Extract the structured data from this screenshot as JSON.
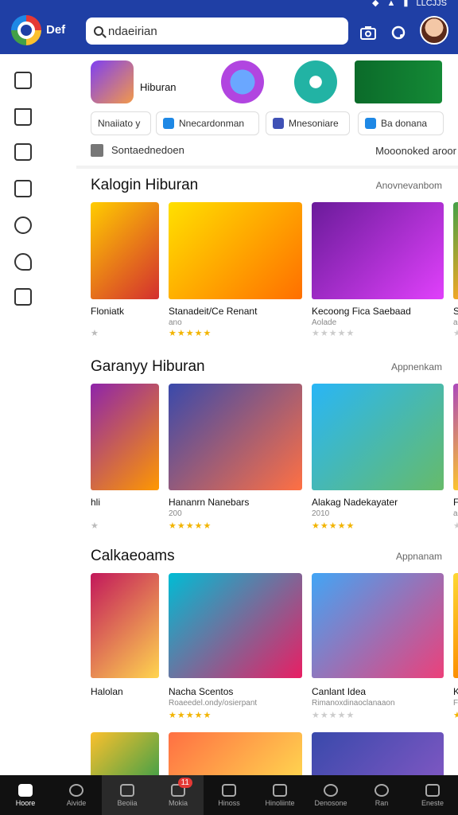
{
  "status": {
    "time": "LLCJJS"
  },
  "header": {
    "brand": "Def",
    "search_value": "ndaeirian"
  },
  "featured": {
    "label": "Hiburan"
  },
  "chips": [
    {
      "label": "Nnaiiato y"
    },
    {
      "label": "Nnecardonman"
    },
    {
      "label": "Mnesoniare"
    },
    {
      "label": "Ba donana"
    }
  ],
  "notice": {
    "left": "Sontaednedoen",
    "right": "Mooonoked aroor"
  },
  "sections": [
    {
      "title": "Kalogin Hiburan",
      "more": "Anovnevanbom",
      "cards": [
        {
          "title": "Floniatk",
          "sub": "",
          "stars": "★"
        },
        {
          "title": "Stanadeit/Ce Renant",
          "sub": "ano",
          "stars": "★★★★★"
        },
        {
          "title": "Kecoong Fica Saebaad",
          "sub": "Aolade",
          "stars": "★★★★★"
        },
        {
          "title": "S",
          "sub": "ae",
          "stars": "★"
        }
      ]
    },
    {
      "title": "Garanyy Hiburan",
      "more": "Appnenkam",
      "cards": [
        {
          "title": "hli",
          "sub": "",
          "stars": "★"
        },
        {
          "title": "Hananrn Nanebars",
          "sub": "200",
          "stars": "★★★★★"
        },
        {
          "title": "Alakag Nadekayater",
          "sub": "2010",
          "stars": "★★★★★"
        },
        {
          "title": "F",
          "sub": "ao",
          "stars": "★"
        }
      ]
    },
    {
      "title": "Calkaeoams",
      "more": "Appnanam",
      "cards": [
        {
          "title": "Halolan",
          "sub": "",
          "stars": ""
        },
        {
          "title": "Nacha Scentos",
          "sub": "Roaeedel.ondy/osierpant",
          "stars": "★★★★★"
        },
        {
          "title": "Canlant Idea",
          "sub": "Rimanoxdinaoclanaaon",
          "stars": "★★★★★"
        },
        {
          "title": "K",
          "sub": "F",
          "stars": "★"
        }
      ]
    }
  ],
  "bottom_nav": [
    {
      "label": "Hoore"
    },
    {
      "label": "Aivide"
    },
    {
      "label": "Beoiia"
    },
    {
      "label": "Mokia",
      "badge": "11"
    },
    {
      "label": "Hinoss"
    },
    {
      "label": "Hinoliinte"
    },
    {
      "label": "Denosone"
    },
    {
      "label": "Ran"
    },
    {
      "label": "Eneste"
    }
  ]
}
